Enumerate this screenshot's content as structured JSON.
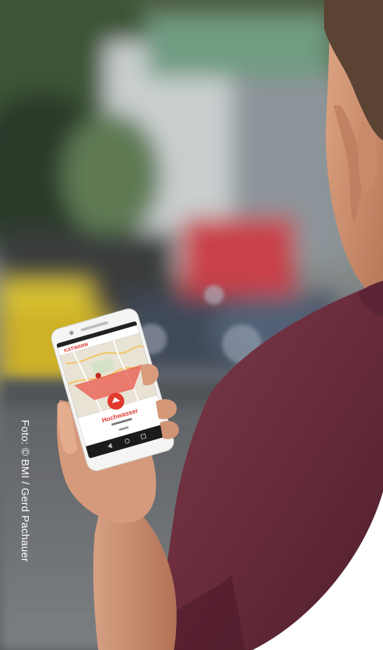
{
  "photo": {
    "app_brand": "KATWARN",
    "alert_title": "Hochwasser"
  },
  "credit": {
    "text": "Foto: © BMI / Gerd Pachauer"
  }
}
